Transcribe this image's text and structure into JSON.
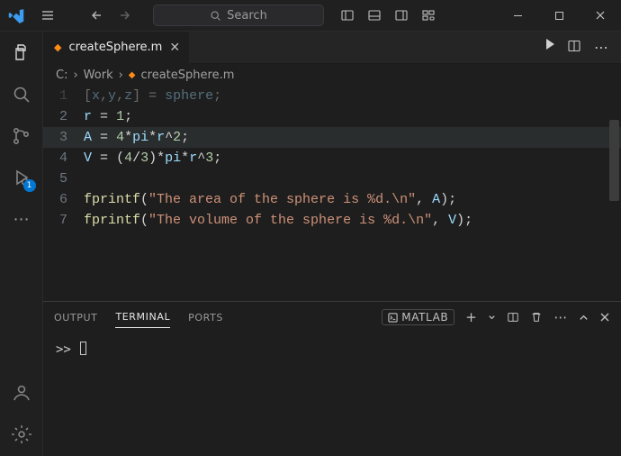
{
  "titlebar": {
    "search_placeholder": "Search"
  },
  "tab": {
    "label": "createSphere.m"
  },
  "breadcrumb": {
    "parts": [
      "C:",
      "Work",
      "createSphere.m"
    ]
  },
  "editor": {
    "lines": [
      {
        "n": 1,
        "raw": "[x,y,z] = sphere;",
        "faded": true
      },
      {
        "n": 2,
        "raw": "r = 1;"
      },
      {
        "n": 3,
        "raw": "A = 4*pi*r^2;",
        "highlight": true
      },
      {
        "n": 4,
        "raw": "V = (4/3)*pi*r^3;"
      },
      {
        "n": 5,
        "raw": ""
      },
      {
        "n": 6,
        "raw": "fprintf(\"The area of the sphere is %d.\\n\", A);"
      },
      {
        "n": 7,
        "raw": "fprintf(\"The volume of the sphere is %d.\\n\", V);"
      }
    ]
  },
  "panel": {
    "tabs": {
      "output": "OUTPUT",
      "terminal": "TERMINAL",
      "ports": "PORTS"
    },
    "kernel": "MATLAB",
    "prompt": ">>"
  },
  "activity": {
    "badge": "1"
  },
  "icons": {
    "menu": "≡",
    "back": "←",
    "fwd": "→",
    "search": "⌕",
    "more": "⋯",
    "min": "—",
    "max": "▢",
    "close": "✕",
    "plus": "+",
    "trash": "🗑",
    "chev_up": "˄",
    "split_h": "▯▯"
  }
}
